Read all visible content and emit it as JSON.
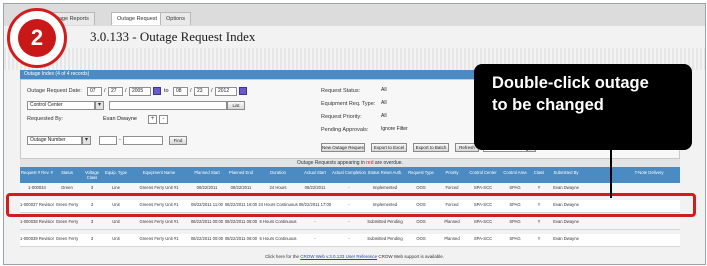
{
  "tabs": [
    {
      "label": "Outage Reports"
    },
    {
      "label": "Outage Request"
    },
    {
      "label": "Options"
    }
  ],
  "page_title": "3.0.133 - Outage Request Index",
  "step_number": "2",
  "callout_text_line1": "Double-click outage",
  "callout_text_line2": "to be changed",
  "panel": {
    "header": "Outage Index (4 of 4 records)",
    "request_date_label": "Outage Request Date:",
    "date_from": {
      "month": "07",
      "day": "27",
      "year": "2005"
    },
    "to_label": "to",
    "date_to": {
      "month": "08",
      "day": "23",
      "year": "2012"
    },
    "control_center_select": "Control Center",
    "list_button": "List",
    "requested_by_label": "Requested By:",
    "requested_by_value": "Evan Dwayne",
    "outage_number_select": "Outage Number",
    "find_button": "Find",
    "request_status_label": "Request Status:",
    "request_status_value": "All",
    "equipment_type_label": "Equipment Req. Type:",
    "equipment_type_value": "All",
    "request_priority_label": "Request Priority:",
    "request_priority_value": "All",
    "pending_approvals_label": "Pending Approvals:",
    "pending_approvals_value": "Ignore Filter",
    "buttons": [
      "New Outage Request",
      "Export to Excel",
      "Export to Batch",
      "Refresh"
    ],
    "auto_refresh_select": "No Auto Refresh"
  },
  "grid": {
    "caption_prefix": "Outage Requests appearing in",
    "caption_red": "red",
    "caption_suffix": "are overdue.",
    "columns": [
      "Request # Rev. #",
      "Status",
      "Voltage Class",
      "Equip. Type",
      "Equipment Name",
      "Planned Start",
      "Planned End",
      "Duration",
      "Actual Start",
      "Actual Completion",
      "Status Reset Auth.",
      "Request Type",
      "Priority",
      "Control Center",
      "Control Area",
      "Class",
      "Submitted By",
      "T-Note Delivery"
    ],
    "rows": [
      [
        "1-000034",
        "Green",
        "3",
        "Line",
        "Greens Ferry Unit #1",
        "08/22/2011",
        "08/22/2011",
        "24 Hours",
        "08/22/2011",
        "-",
        "Implemented",
        "OOS",
        "Forced",
        "SPA-SCC",
        "SPAG",
        "Y",
        "Evan Dwayne",
        ""
      ],
      [
        "1-000037 Revision #1",
        "Green Ferry",
        "3",
        "Unit",
        "Greens Ferry Unit #1",
        "08/22/2011 11:00",
        "08/22/2011 16:00",
        "24 Hours Continuous",
        "08/22/2011 17:00",
        "-",
        "Implemented",
        "OOS",
        "Forced",
        "SPA-SCC",
        "SPAG",
        "Y",
        "Evan Dwayne",
        ""
      ],
      [
        "1-000038 Revision #1",
        "Green Ferry",
        "3",
        "Unit",
        "Greens Ferry Unit #1",
        "08/22/2011 00:00",
        "08/22/2011 06:00",
        "6 Hours Continuous",
        "-",
        "-",
        "Submitted Pending",
        "OOS",
        "Planned",
        "SPA-SCC",
        "SPAG",
        "Y",
        "Evan Dwayne",
        ""
      ],
      [
        "1-000039 Revision #1",
        "Green Ferry",
        "3",
        "Unit",
        "Greens Ferry Unit #1",
        "08/22/2011 00:00",
        "08/22/2011 06:00",
        "6 Hours Continuous",
        "-",
        "-",
        "Submitted Pending",
        "OOS",
        "Planned",
        "SPA-SCC",
        "SPAG",
        "Y",
        "Evan Dwayne",
        ""
      ]
    ]
  },
  "footer": {
    "prefix": "Click here for the",
    "link": "CROW Web v.3.0.133 User Reference",
    "suffix": "CROW Web support is available."
  },
  "colors": {
    "accent_blue": "#4b8bc4",
    "highlight_red": "#d31d1d"
  }
}
